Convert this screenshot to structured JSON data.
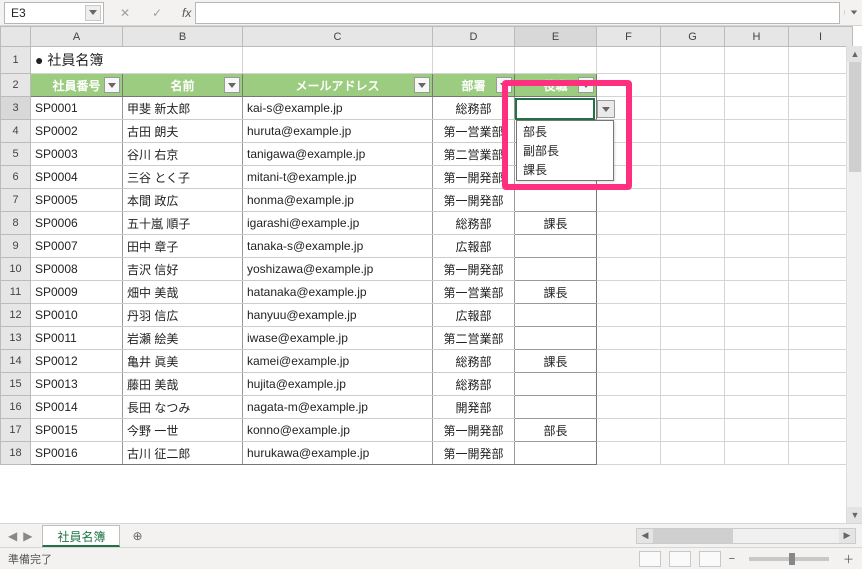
{
  "cell_ref": "E3",
  "fx_label": "fx",
  "title": "社員名簿",
  "columns": [
    "A",
    "B",
    "C",
    "D",
    "E",
    "F",
    "G",
    "H",
    "I"
  ],
  "roster_headers": [
    "社員番号",
    "名前",
    "メールアドレス",
    "部署",
    "役職"
  ],
  "rows": [
    {
      "no": "SP0001",
      "name": "甲斐 新太郎",
      "mail": "kai-s@example.jp",
      "dept": "総務部",
      "role": ""
    },
    {
      "no": "SP0002",
      "name": "古田 朗夫",
      "mail": "huruta@example.jp",
      "dept": "第一営業部",
      "role": ""
    },
    {
      "no": "SP0003",
      "name": "谷川 右京",
      "mail": "tanigawa@example.jp",
      "dept": "第二営業部",
      "role": ""
    },
    {
      "no": "SP0004",
      "name": "三谷 とく子",
      "mail": "mitani-t@example.jp",
      "dept": "第一開発部",
      "role": ""
    },
    {
      "no": "SP0005",
      "name": "本間 政広",
      "mail": "honma@example.jp",
      "dept": "第一開発部",
      "role": ""
    },
    {
      "no": "SP0006",
      "name": "五十嵐 順子",
      "mail": "igarashi@example.jp",
      "dept": "総務部",
      "role": "課長"
    },
    {
      "no": "SP0007",
      "name": "田中 章子",
      "mail": "tanaka-s@example.jp",
      "dept": "広報部",
      "role": ""
    },
    {
      "no": "SP0008",
      "name": "吉沢 信好",
      "mail": "yoshizawa@example.jp",
      "dept": "第一開発部",
      "role": ""
    },
    {
      "no": "SP0009",
      "name": "畑中 美哉",
      "mail": "hatanaka@example.jp",
      "dept": "第一営業部",
      "role": "課長"
    },
    {
      "no": "SP0010",
      "name": "丹羽 信広",
      "mail": "hanyuu@example.jp",
      "dept": "広報部",
      "role": ""
    },
    {
      "no": "SP0011",
      "name": "岩瀬 絵美",
      "mail": "iwase@example.jp",
      "dept": "第二営業部",
      "role": ""
    },
    {
      "no": "SP0012",
      "name": "亀井 眞美",
      "mail": "kamei@example.jp",
      "dept": "総務部",
      "role": "課長"
    },
    {
      "no": "SP0013",
      "name": "藤田 美哉",
      "mail": "hujita@example.jp",
      "dept": "総務部",
      "role": ""
    },
    {
      "no": "SP0014",
      "name": "長田 なつみ",
      "mail": "nagata-m@example.jp",
      "dept": "開発部",
      "role": ""
    },
    {
      "no": "SP0015",
      "name": "今野 一世",
      "mail": "konno@example.jp",
      "dept": "第一開発部",
      "role": "部長"
    },
    {
      "no": "SP0016",
      "name": "古川 征二郎",
      "mail": "hurukawa@example.jp",
      "dept": "第一開発部",
      "role": ""
    }
  ],
  "dropdown_options": [
    "部長",
    "副部長",
    "課長"
  ],
  "sheet_tab": "社員名簿",
  "new_sheet": "⊕",
  "status_text": "準備完了",
  "zoom_minus": "−",
  "zoom_plus": "＋",
  "nav_first": "⏮",
  "nav_prev": "◀",
  "nav_next": "▶",
  "nav_last": "⏭",
  "cancel_glyph": "✕",
  "check_glyph": "✓"
}
